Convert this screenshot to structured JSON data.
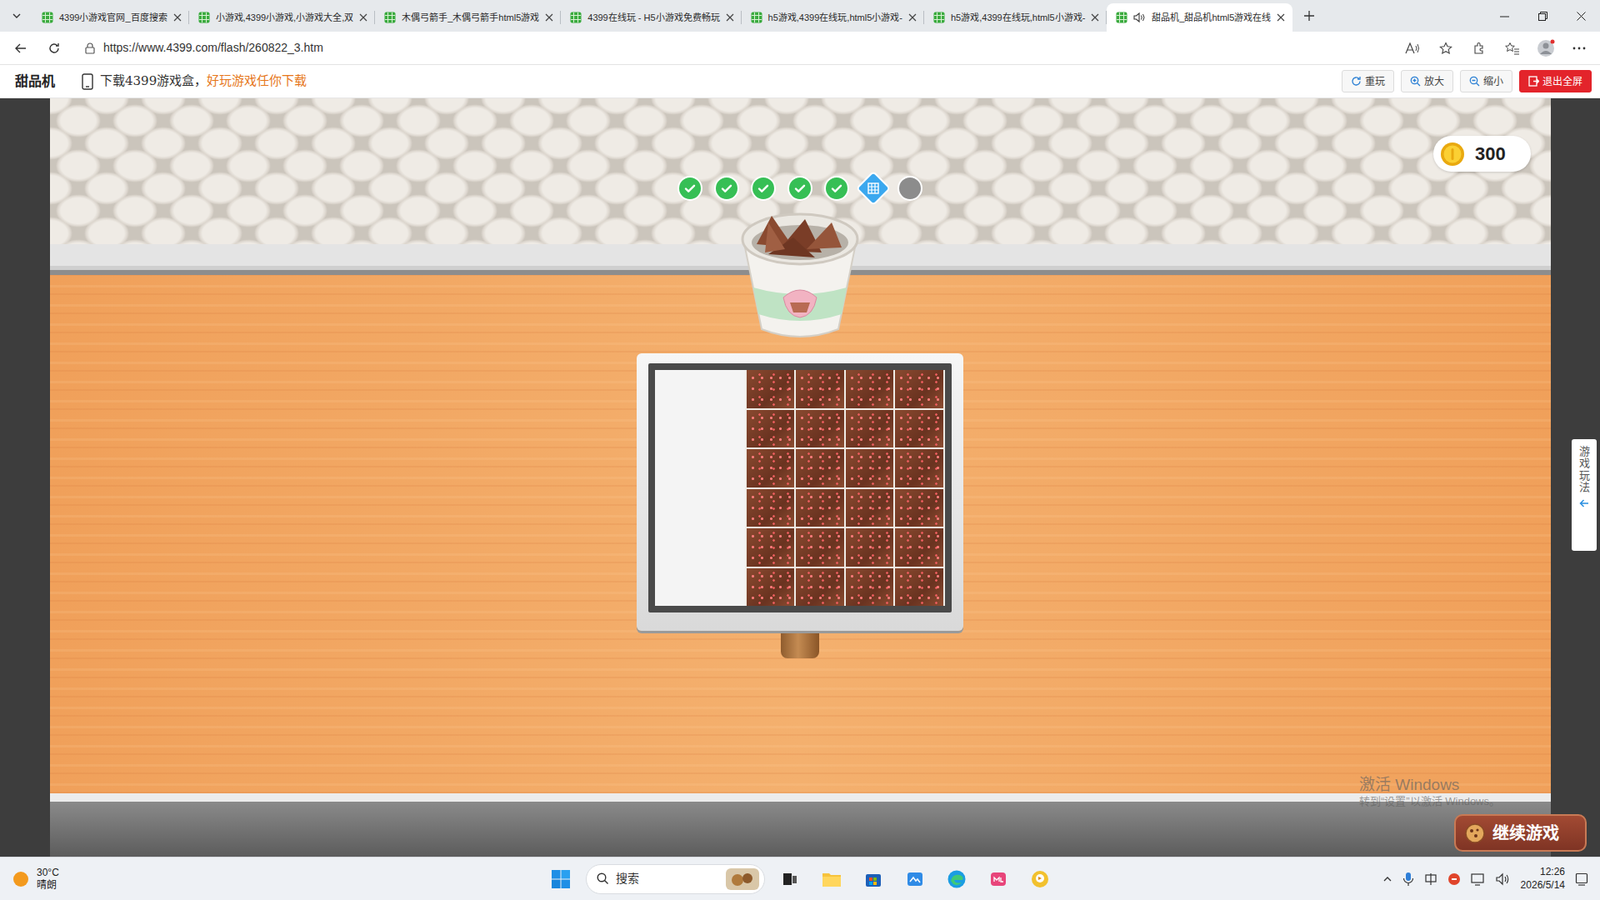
{
  "browser": {
    "tabs": [
      {
        "label": "4399小游戏官网_百度搜索",
        "selected": false,
        "audio": false
      },
      {
        "label": "小游戏,4399小游戏,小游戏大全,双",
        "selected": false,
        "audio": false
      },
      {
        "label": "木偶弓箭手_木偶弓箭手html5游戏",
        "selected": false,
        "audio": false
      },
      {
        "label": "4399在线玩 - H5小游戏免费畅玩",
        "selected": false,
        "audio": false
      },
      {
        "label": "h5游戏,4399在线玩,html5小游戏-",
        "selected": false,
        "audio": false
      },
      {
        "label": "h5游戏,4399在线玩,html5小游戏-",
        "selected": false,
        "audio": false
      },
      {
        "label": "甜品机_甜品机html5游戏在线",
        "selected": true,
        "audio": true
      }
    ],
    "address": "https://www.4399.com/flash/260822_3.htm"
  },
  "game_bar": {
    "title": "甜品机",
    "promo": "下载4399游戏盒，",
    "promo_link": "好玩游戏任你下载",
    "buttons": [
      {
        "label": "重玩",
        "kind": "replay"
      },
      {
        "label": "放大",
        "kind": "zoomin"
      },
      {
        "label": "缩小",
        "kind": "zoomout"
      },
      {
        "label": "退出全屏",
        "kind": "exit"
      }
    ]
  },
  "game": {
    "steps": [
      {
        "state": "done"
      },
      {
        "state": "done"
      },
      {
        "state": "done"
      },
      {
        "state": "done"
      },
      {
        "state": "done"
      },
      {
        "state": "current"
      },
      {
        "state": "pending"
      }
    ],
    "coins": "300",
    "tray": {
      "rows": 6,
      "cols": 4
    },
    "continue_button": "继续游戏",
    "side_tab": "游戏玩法"
  },
  "watermark": {
    "title": "激活 Windows",
    "subtitle": "转到“设置”以激活 Windows。"
  },
  "taskbar": {
    "temperature": "30°C",
    "weather": "晴朗",
    "search": "搜索",
    "time": "12:26",
    "date": "2026/5/14"
  }
}
